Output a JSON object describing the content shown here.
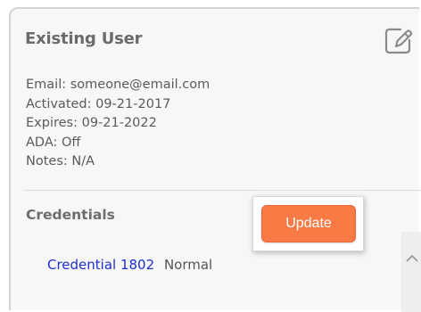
{
  "card": {
    "title": "Existing User",
    "edit_icon": "edit-icon"
  },
  "info": {
    "email": "Email: someone@email.com",
    "activated": "Activated: 09-21-2017",
    "expires": "Expires: 09-21-2022",
    "ada": "ADA: Off",
    "notes": "Notes: N/A"
  },
  "credentials": {
    "heading": "Credentials",
    "items": [
      {
        "name": "Credential 1802",
        "status": "Normal"
      }
    ]
  },
  "popup": {
    "update_label": "Update"
  },
  "colors": {
    "accent": "#f97a44",
    "link": "#1d2fd0",
    "card_bg": "#f7f7f7"
  },
  "icons": {
    "scroll": "chevron-up-icon"
  }
}
